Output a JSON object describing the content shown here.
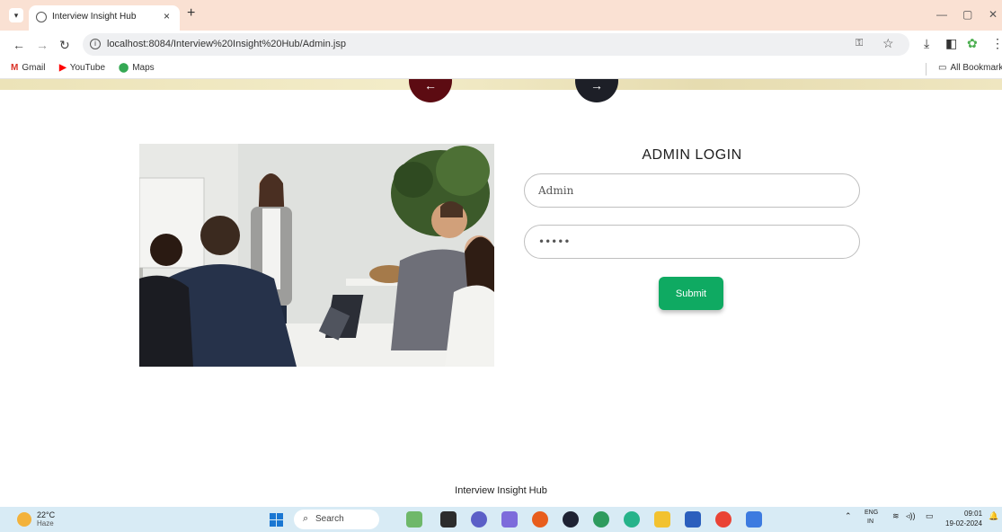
{
  "browser": {
    "tab_title": "Interview Insight Hub",
    "tab_close": "×",
    "new_tab": "+",
    "url": "localhost:8084/Interview%20Insight%20Hub/Admin.jsp",
    "window_minimize": "—",
    "window_maximize": "▢",
    "window_close": "✕",
    "bookmarks": [
      {
        "label": "Gmail",
        "icon": "gmail-icon",
        "color": "#d93025"
      },
      {
        "label": "YouTube",
        "icon": "youtube-icon",
        "color": "#ff0000"
      },
      {
        "label": "Maps",
        "icon": "maps-icon",
        "color": "#34a853"
      }
    ],
    "all_bookmarks": "All Bookmarks"
  },
  "page": {
    "arrow_left": "←",
    "arrow_right": "→",
    "login_title": "ADMIN LOGIN",
    "username_value": "Admin",
    "password_value": "•••••",
    "submit_label": "Submit",
    "footer": "Interview Insight Hub",
    "colors": {
      "submit_green": "#0faa62",
      "arrow_left_maroon": "#5c0b12",
      "arrow_right_dark": "#1d1f27"
    }
  },
  "taskbar": {
    "temperature": "22°C",
    "weather": "Haze",
    "search_label": "Search",
    "lang_top": "ENG",
    "lang_bottom": "IN",
    "time": "09:01",
    "date": "19-02-2024"
  }
}
